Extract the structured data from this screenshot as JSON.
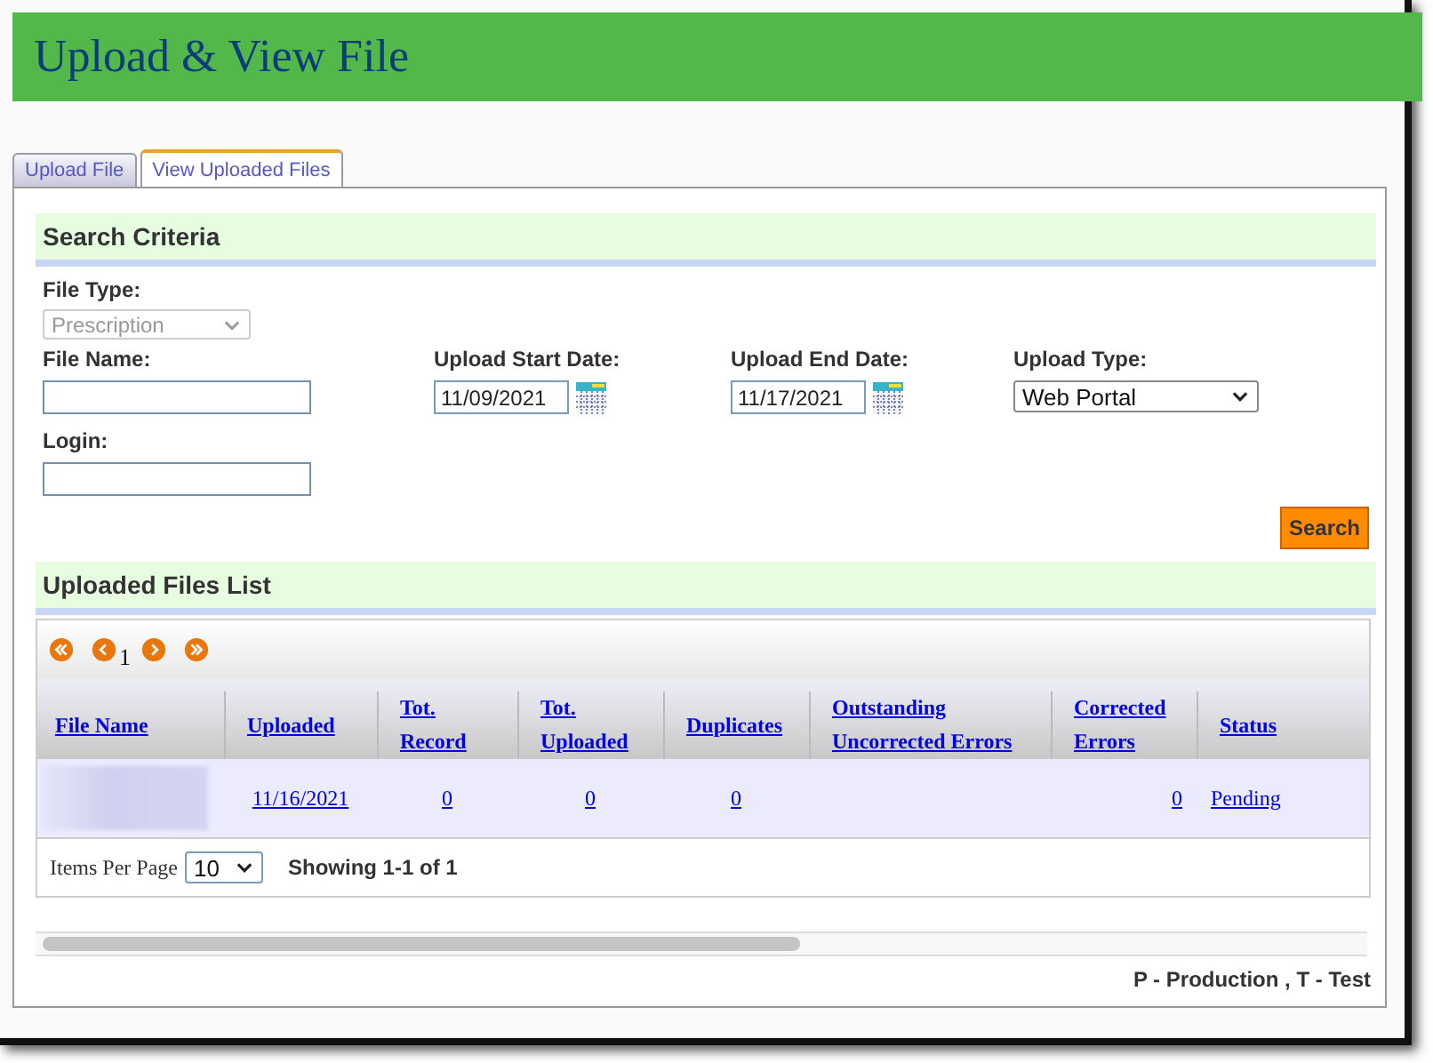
{
  "header": {
    "title": "Upload & View File"
  },
  "tabs": [
    {
      "label": "Upload File",
      "selected": false
    },
    {
      "label": "View Uploaded Files",
      "selected": true
    }
  ],
  "search_criteria": {
    "title": "Search Criteria",
    "file_type": {
      "label": "File Type:",
      "value": "Prescription",
      "disabled": true
    },
    "file_name": {
      "label": "File Name:"
    },
    "login": {
      "label": "Login:"
    },
    "start_date": {
      "label": "Upload Start Date:",
      "value": "11/09/2021"
    },
    "end_date": {
      "label": "Upload End Date:",
      "value": "11/17/2021"
    },
    "upload_type": {
      "label": "Upload Type:",
      "value": "Web Portal"
    },
    "search_button": "Search"
  },
  "files_list": {
    "title": "Uploaded Files List",
    "page": "1",
    "columns": [
      "File Name",
      "Uploaded",
      "Tot.\nRecord",
      "Tot.\nUploaded",
      "Duplicates",
      "Outstanding\nUncorrected Errors",
      "Corrected\nErrors",
      "Status"
    ],
    "rows": [
      {
        "cells": [
          {
            "kind": "blurred"
          },
          {
            "kind": "link",
            "text": "11/16/2021"
          },
          {
            "kind": "link",
            "text": "0"
          },
          {
            "kind": "link",
            "text": "0"
          },
          {
            "kind": "link",
            "text": "0"
          },
          {
            "kind": "empty"
          },
          {
            "kind": "link",
            "text": "0"
          },
          {
            "kind": "link",
            "text": "Pending"
          }
        ]
      }
    ],
    "items_per_page_label": "Items Per Page",
    "items_per_page": "10",
    "showing": "Showing 1-1 of 1"
  },
  "legend": "P - Production , T - Test"
}
